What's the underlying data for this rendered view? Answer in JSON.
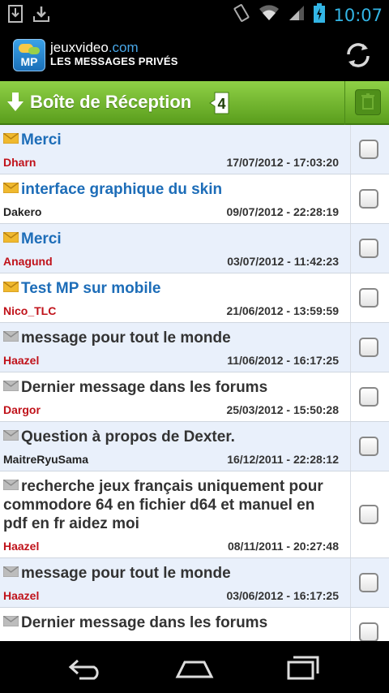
{
  "status_bar": {
    "time": "10:07",
    "left_icons": [
      "download-icon",
      "download-icon"
    ],
    "right_icons": [
      "vibrate-icon",
      "wifi-icon",
      "signal-icon",
      "battery-charging-icon"
    ],
    "time_color": "#33b5e5"
  },
  "header": {
    "logo_text": "MP",
    "site_name_main": "jeuxvideo",
    "site_name_tld": ".com",
    "subtitle": "LES MESSAGES PRIVÉS",
    "refresh_icon": "refresh-icon"
  },
  "inbox": {
    "title": "Boîte de Réception",
    "count": "4",
    "trash_icon": "trash-icon",
    "accent_color": "#6eb52b"
  },
  "messages": [
    {
      "subject": "Merci",
      "author": "Dharn",
      "date": "17/07/2012 - 17:03:20",
      "unread": true,
      "author_color": "#c0121a"
    },
    {
      "subject": "interface graphique du skin",
      "author": "Dakero",
      "date": "09/07/2012 - 22:28:19",
      "unread": true,
      "author_color": "#222222"
    },
    {
      "subject": "Merci",
      "author": "Anagund",
      "date": "03/07/2012 - 11:42:23",
      "unread": true,
      "author_color": "#c0121a"
    },
    {
      "subject": "Test MP sur mobile",
      "author": "Nico_TLC",
      "date": "21/06/2012 - 13:59:59",
      "unread": true,
      "author_color": "#c0121a"
    },
    {
      "subject": "message pour tout le monde",
      "author": "Haazel",
      "date": "11/06/2012 - 16:17:25",
      "unread": false,
      "author_color": "#c0121a"
    },
    {
      "subject": "Dernier message dans les forums",
      "author": "Dargor",
      "date": "25/03/2012 - 15:50:28",
      "unread": false,
      "author_color": "#c0121a"
    },
    {
      "subject": "Question à propos de Dexter.",
      "author": "MaitreRyuSama",
      "date": "16/12/2011 - 22:28:12",
      "unread": false,
      "author_color": "#222222"
    },
    {
      "subject": "recherche jeux français uniquement pour commodore 64 en fichier d64 et manuel en pdf en fr aidez moi",
      "author": "Haazel",
      "date": "08/11/2011 - 20:27:48",
      "unread": false,
      "author_color": "#c0121a"
    },
    {
      "subject": "message pour tout le monde",
      "author": "Haazel",
      "date": "03/06/2012 - 16:17:25",
      "unread": false,
      "author_color": "#c0121a"
    },
    {
      "subject": "Dernier message dans les forums",
      "author": "",
      "date": "",
      "unread": false,
      "author_color": "#c0121a"
    }
  ],
  "nav_bar": {
    "buttons": [
      "back-icon",
      "home-icon",
      "recents-icon"
    ]
  }
}
